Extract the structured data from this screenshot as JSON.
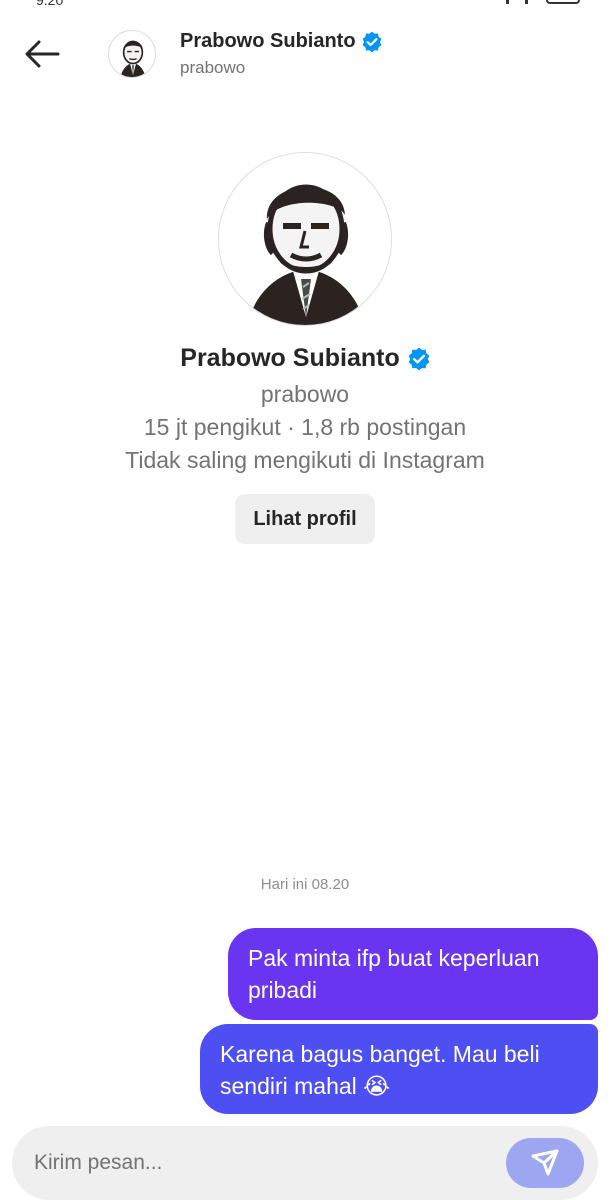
{
  "status_bar": {
    "time": "9.20"
  },
  "header": {
    "name": "Prabowo Subianto",
    "handle": "prabowo",
    "back_icon": "arrow-left-icon",
    "verified_icon": "verified-badge-icon"
  },
  "profile": {
    "name": "Prabowo Subianto",
    "handle": "prabowo",
    "stats": "15 jt pengikut · 1,8 rb postingan",
    "follow_status": "Tidak saling mengikuti di Instagram",
    "view_profile_label": "Lihat profil"
  },
  "conversation": {
    "timestamp": "Hari ini 08.20",
    "messages": [
      {
        "text": "Pak minta ifp buat keperluan pribadi",
        "from": "me",
        "color": "#6a35f0"
      },
      {
        "text": "Karena bagus banget. Mau beli sendiri mahal 😭",
        "from": "me",
        "color": "#4d4ff2"
      }
    ]
  },
  "composer": {
    "placeholder": "Kirim pesan...",
    "send_icon": "send-icon"
  },
  "colors": {
    "verified": "#0095f6",
    "bubble_top": "#6a35f0",
    "bubble_bottom": "#4d4ff2",
    "send_button": "#9da6f1"
  }
}
